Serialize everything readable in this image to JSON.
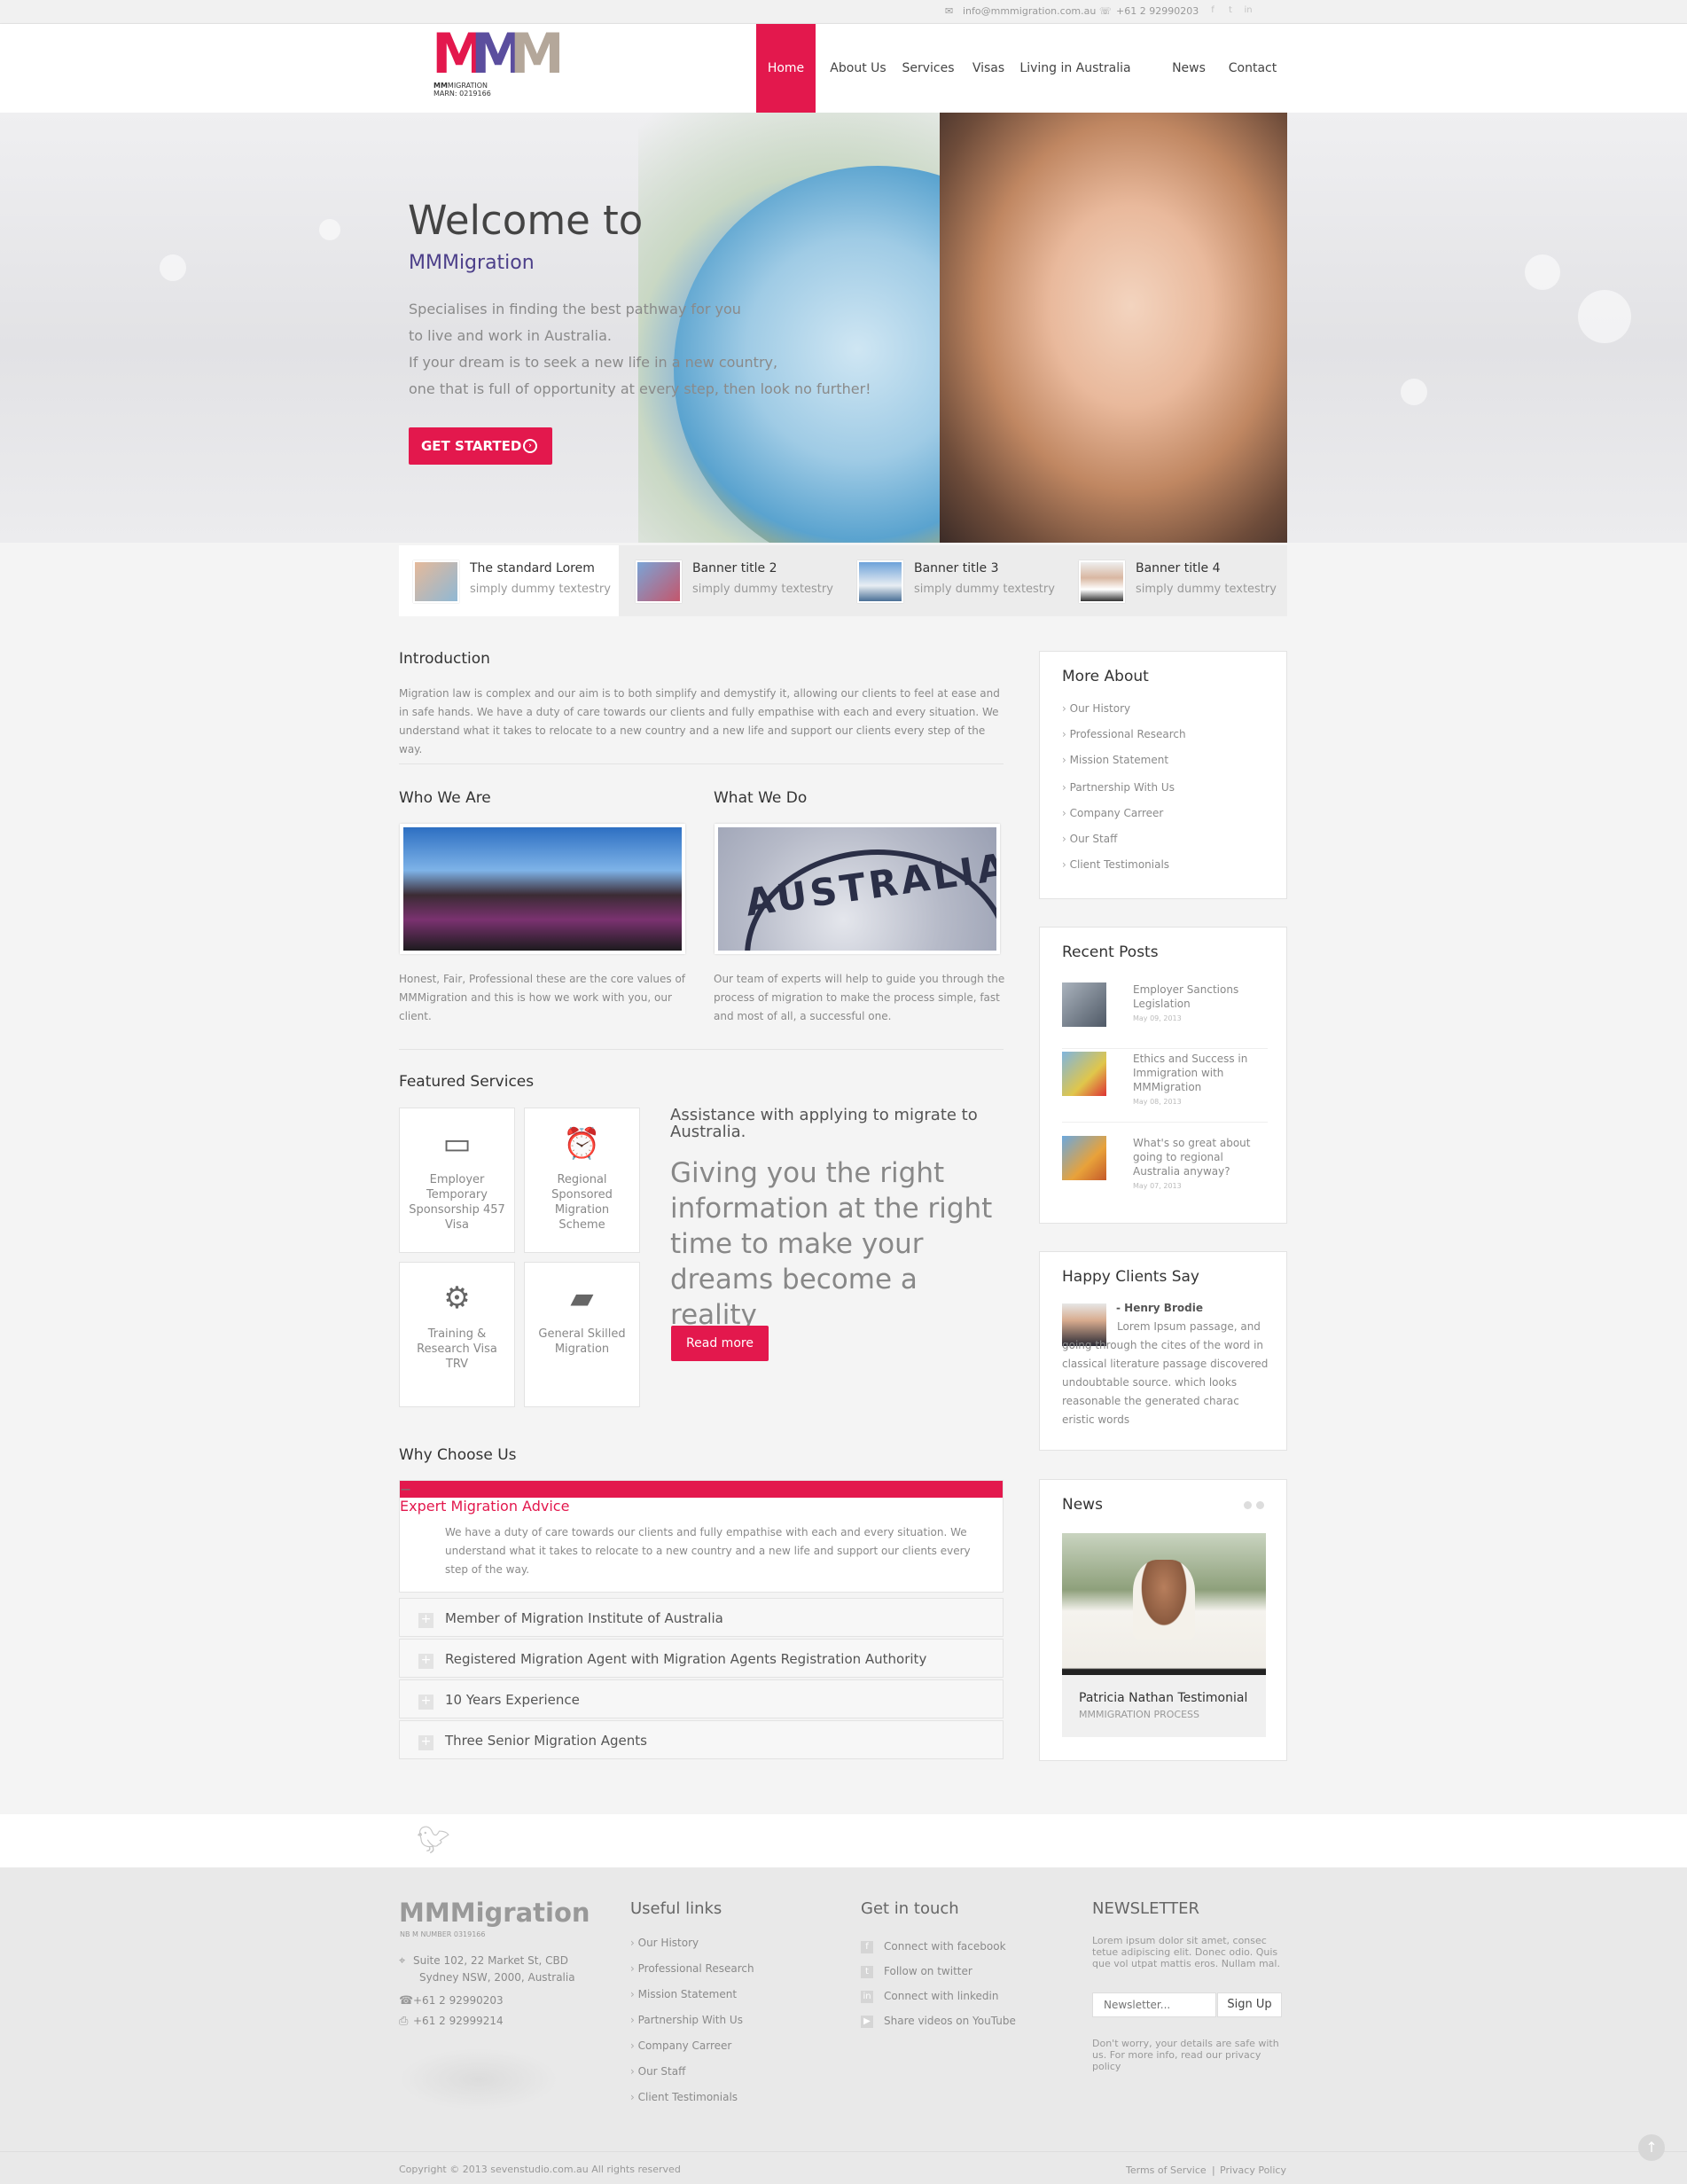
{
  "topbar": {
    "email": "info@mmmigration.com.au",
    "phone": "+61 2 92990203",
    "social": [
      "facebook-icon",
      "twitter-icon",
      "linkedin-icon"
    ]
  },
  "logo": {
    "letters": [
      "M",
      "M",
      "M"
    ],
    "colors": [
      "#e3184d",
      "#5b4e9e",
      "#b4a79a"
    ],
    "line1_bold": "MM",
    "line1_rest": "MIGRATION",
    "line2": "MARN: 0219166"
  },
  "nav": {
    "items": [
      "Home",
      "About Us",
      "Services",
      "Visas",
      "Living in Australia",
      "News",
      "Contact"
    ],
    "active": "Home"
  },
  "hero": {
    "title": "Welcome to",
    "subtitle": "MMMigration",
    "lines": [
      "Specialises in finding the best pathway for you",
      "to live and work in Australia.",
      "If your dream is to seek a new life in a new country,",
      "one that is full of opportunity at every step, then look no further!"
    ],
    "cta": "GET STARTED"
  },
  "banners": [
    {
      "title": "The standard Lorem",
      "sub": "simply dummy textestry"
    },
    {
      "title": "Banner title 2",
      "sub": "simply dummy textestry"
    },
    {
      "title": "Banner title 3",
      "sub": "simply dummy textestry"
    },
    {
      "title": "Banner title 4",
      "sub": "simply dummy textestry"
    }
  ],
  "intro": {
    "title": "Introduction",
    "text": "Migration law is complex and our aim is to both simplify and demystify it, allowing our clients to feel at ease and in safe hands. We have a duty of care towards our clients and fully empathise with each and every situation. We understand what it takes to relocate to a new country and a new life and support our clients every step of the way."
  },
  "who": {
    "title": "Who We Are",
    "text": "Honest, Fair, Professional these are the core values of MMMigration and this is how we work with you, our client."
  },
  "what": {
    "title": "What We Do",
    "stamp": "AUSTRALIA",
    "text": "Our team of experts will help to guide you through the process of migration to make the process simple, fast and most of all, a successful one."
  },
  "featured": {
    "title": "Featured Services",
    "services": [
      {
        "label": "Employer Temporary Sponsorship 457 Visa",
        "icon": "monitor-icon"
      },
      {
        "label": "Regional Sponsored Migration Scheme",
        "icon": "alarm-clock-icon"
      },
      {
        "label": "Training & Research Visa TRV",
        "icon": "gear-icon"
      },
      {
        "label": "General Skilled Migration",
        "icon": "folder-icon"
      }
    ],
    "assist_title": "Assistance with applying to migrate to Australia.",
    "assist_big": "Giving you the right information at the right time to make your dreams become a reality",
    "read_more": "Read more"
  },
  "why": {
    "title": "Why Choose Us",
    "open_title": "Expert Migration Advice",
    "open_text": "We have a duty of care towards our clients and fully empathise with each and every situation. We understand what it takes to relocate to a new country and a new life and support our clients every step of the way.",
    "items": [
      "Member of Migration Institute of Australia",
      "Registered Migration Agent with Migration Agents Registration Authority",
      "10 Years Experience",
      "Three Senior Migration Agents"
    ]
  },
  "sidebar": {
    "more_title": "More About",
    "more_links": [
      "Our History",
      "Professional Research",
      "Mission Statement",
      "Partnership With Us",
      "Company Carreer",
      "Our Staff",
      "Client Testimonials"
    ],
    "recent_title": "Recent Posts",
    "posts": [
      {
        "title": "Employer Sanctions Legislation",
        "date": "May 09, 2013"
      },
      {
        "title": "Ethics and Success in Immigration with MMMigration",
        "date": "May 08, 2013"
      },
      {
        "title": "What's so great about going to regional Australia anyway?",
        "date": "May 07, 2013"
      }
    ],
    "clients_title": "Happy Clients Say",
    "client_name": "- Henry Brodie",
    "client_text": "Lorem Ipsum passage, and going through the cites of the word in classical literature passage discovered undoubtable source. which looks reasonable the generated charac eristic words",
    "news_title": "News",
    "news_caption": "Patricia Nathan Testimonial",
    "news_sub": "MMMIGRATION PROCESS"
  },
  "footer": {
    "brand": "MMMigration",
    "brand_sub": "NB M NUMBER 0319166",
    "address1": "Suite 102, 22 Market St, CBD",
    "address2": "Sydney NSW, 2000, Australia",
    "phone": "+61 2 92990203",
    "fax": "+61 2 92999214",
    "useful_title": "Useful links",
    "useful_links": [
      "Our History",
      "Professional Research",
      "Mission Statement",
      "Partnership With Us",
      "Company Carreer",
      "Our Staff",
      "Client Testimonials"
    ],
    "touch_title": "Get in touch",
    "touch": [
      "Connect with facebook",
      "Follow on twitter",
      "Connect with linkedin",
      "Share videos on YouTube"
    ],
    "newsletter_title": "NEWSLETTER",
    "newsletter_text": "Lorem ipsum dolor sit amet, consec tetue adipiscing elit. Donec odio. Quis que vol utpat mattis eros. Nullam mal.",
    "newsletter_placeholder": "Newsletter...",
    "signup": "Sign Up",
    "newsletter_note": "Don't worry, your details are safe with us. For more info, read our privacy policy",
    "copyright": "Copyright © 2013 sevenstudio.com.au All rights reserved",
    "terms": "Terms of Service",
    "privacy": "Privacy Policy",
    "sep": "|"
  },
  "accent": "#e3184d"
}
